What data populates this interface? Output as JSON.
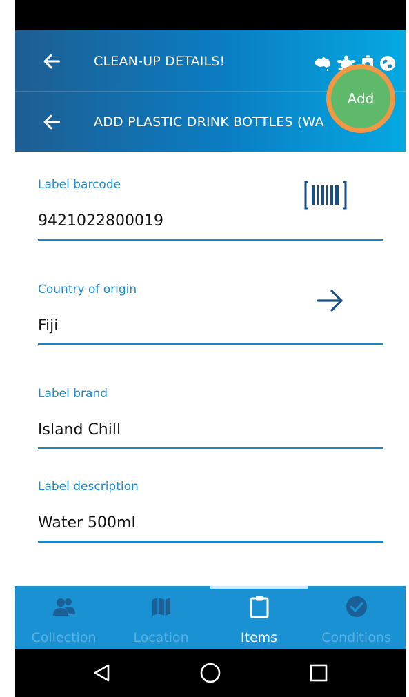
{
  "colors": {
    "header_start": "#1e5d92",
    "header_end": "#05a9e2",
    "accent_label": "#1b8ccb",
    "field_line": "#1f83c3",
    "add_button": "#5fb96a",
    "highlight_ring": "#f29743",
    "tabbar": "#1991d3",
    "tab_inactive": "#5bb0df",
    "tab_active": "#ffffff"
  },
  "header": {
    "title": "CLEAN-UP DETAILS!",
    "subtitle": "ADD PLASTIC DRINK BOTTLES (WA",
    "add_label": "Add",
    "logos": [
      "australia-map-icon",
      "turtle-icon",
      "bottle-icon",
      "globe-icon"
    ]
  },
  "form": {
    "fields": [
      {
        "label": "Label barcode",
        "value": "9421022800019",
        "icon": "barcode-icon"
      },
      {
        "label": "Country of origin",
        "value": "Fiji",
        "icon": "arrow-right-icon"
      },
      {
        "label": "Label brand",
        "value": "Island Chill"
      },
      {
        "label": "Label description",
        "value": "Water 500ml"
      }
    ]
  },
  "tabs": [
    {
      "label": "Collection",
      "icon": "people-icon",
      "active": false
    },
    {
      "label": "Location",
      "icon": "map-icon",
      "active": false
    },
    {
      "label": "Items",
      "icon": "clipboard-icon",
      "active": true
    },
    {
      "label": "Conditions",
      "icon": "check-circle-icon",
      "active": false
    }
  ],
  "system_nav": [
    "back-triangle-icon",
    "home-circle-icon",
    "recents-square-icon"
  ]
}
